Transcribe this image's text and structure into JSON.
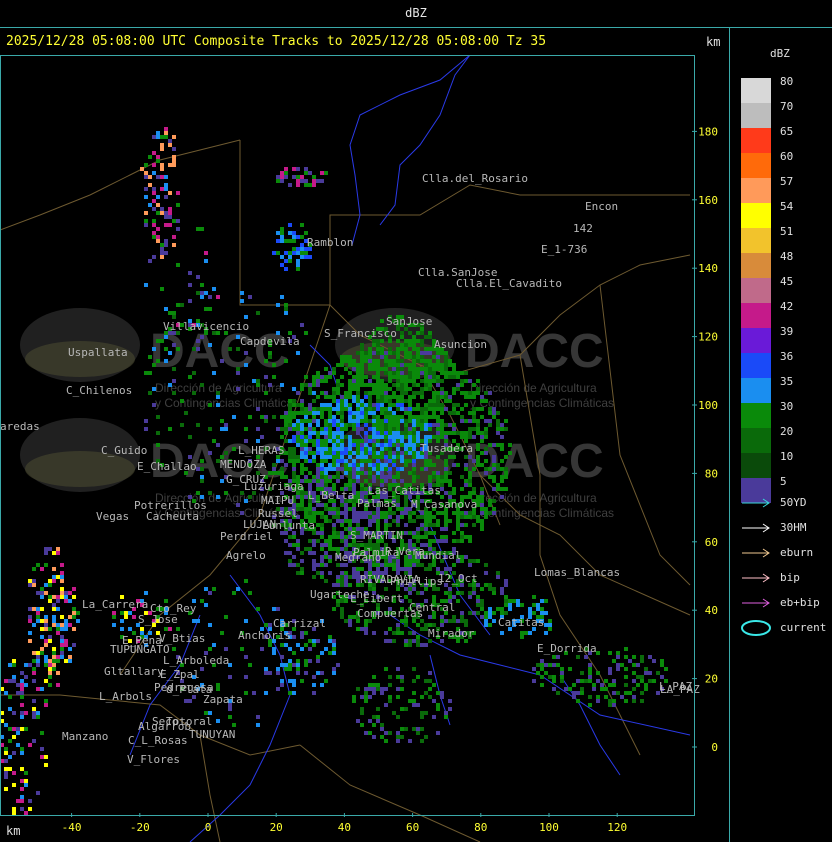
{
  "window_title": "dBZ",
  "header": "2025/12/28 05:08:00 UTC Composite Tracks to 2025/12/28 05:08:00 Tz 35",
  "km_label": "km",
  "legend": {
    "title": "dBZ",
    "scale": [
      {
        "label": "80",
        "color": "#d8d8d8"
      },
      {
        "label": "70",
        "color": "#bdbdbd"
      },
      {
        "label": "65",
        "color": "#ff3a1a"
      },
      {
        "label": "60",
        "color": "#ff6a0a"
      },
      {
        "label": "57",
        "color": "#ff9a5a"
      },
      {
        "label": "54",
        "color": "#ffff00"
      },
      {
        "label": "51",
        "color": "#f2c32c"
      },
      {
        "label": "48",
        "color": "#d88b3a"
      },
      {
        "label": "45",
        "color": "#c06a8a"
      },
      {
        "label": "42",
        "color": "#c51a8a"
      },
      {
        "label": "39",
        "color": "#6a1ad8"
      },
      {
        "label": "36",
        "color": "#1a4af8"
      },
      {
        "label": "35",
        "color": "#1a8ef0"
      },
      {
        "label": "30",
        "color": "#0a8a0a"
      },
      {
        "label": "20",
        "color": "#0a6a0a"
      },
      {
        "label": "10",
        "color": "#0a4a0a"
      },
      {
        "label": "5",
        "color": "#4a3a9a"
      }
    ],
    "tracks": [
      {
        "label": "50YD",
        "color": "#3ad8d8",
        "type": "arrow"
      },
      {
        "label": "30HM",
        "color": "#ffffff",
        "type": "arrow"
      },
      {
        "label": "eburn",
        "color": "#f0c890",
        "type": "arrow"
      },
      {
        "label": "bip",
        "color": "#ffc0c8",
        "type": "arrow"
      },
      {
        "label": "eb+bip",
        "color": "#e060e0",
        "type": "arrow"
      },
      {
        "label": "current",
        "color": "#3ae8e8",
        "type": "ellipse"
      }
    ]
  },
  "axes": {
    "x_ticks": [
      "-40",
      "-20",
      "0",
      "20",
      "40",
      "60",
      "80",
      "100",
      "120"
    ],
    "y_ticks": [
      "180",
      "160",
      "140",
      "120",
      "100",
      "80",
      "60",
      "40",
      "20",
      "0"
    ]
  },
  "places": [
    {
      "name": "Clla.del_Rosario"
    },
    {
      "name": "Encon"
    },
    {
      "name": "142"
    },
    {
      "name": "E_1-736"
    },
    {
      "name": "Ramblon"
    },
    {
      "name": "Clla.SanJose"
    },
    {
      "name": "Clla.El_Cavadito"
    },
    {
      "name": "Villavicencio"
    },
    {
      "name": "Uspallata"
    },
    {
      "name": "Capdevila"
    },
    {
      "name": "S_Francisco"
    },
    {
      "name": "SanJose"
    },
    {
      "name": "Asuncion"
    },
    {
      "name": "C_Chilenos"
    },
    {
      "name": "aredas"
    },
    {
      "name": "C_Guido"
    },
    {
      "name": "E_Challao"
    },
    {
      "name": "L_HERAS"
    },
    {
      "name": "MENDOZA"
    },
    {
      "name": "G_CRUZ"
    },
    {
      "name": "Luzuriaga"
    },
    {
      "name": "L_Belta"
    },
    {
      "name": "Las_Catitas"
    },
    {
      "name": "Tusadera"
    },
    {
      "name": "Potrerillos"
    },
    {
      "name": "Vegas"
    },
    {
      "name": "Cacheuta"
    },
    {
      "name": "MAIPU"
    },
    {
      "name": "Russel"
    },
    {
      "name": "LUJAN"
    },
    {
      "name": "Lunlunta"
    },
    {
      "name": "Palmas"
    },
    {
      "name": "M_Casanova"
    },
    {
      "name": "Perdriel"
    },
    {
      "name": "S_MARTIN"
    },
    {
      "name": "Palmira"
    },
    {
      "name": "R_Vera"
    },
    {
      "name": "Mundial"
    },
    {
      "name": "Agrelo"
    },
    {
      "name": "Medrano"
    },
    {
      "name": "RIVADAVIA"
    },
    {
      "name": "Phillips"
    },
    {
      "name": "12_Oct"
    },
    {
      "name": "Lomas_Blancas"
    },
    {
      "name": "Ugarteche"
    },
    {
      "name": "L_Libert"
    },
    {
      "name": "Compuertas"
    },
    {
      "name": "Central"
    },
    {
      "name": "LA_PAZ"
    },
    {
      "name": "Catitas"
    },
    {
      "name": "La_Carrera"
    },
    {
      "name": "Cto_Rey"
    },
    {
      "name": "S_Jose"
    },
    {
      "name": "Carrizal"
    },
    {
      "name": "E_Pena"
    },
    {
      "name": "TUPUNGATO"
    },
    {
      "name": "V_Btias"
    },
    {
      "name": "Anchoris"
    },
    {
      "name": "Mirador"
    },
    {
      "name": "E_Dorrida"
    },
    {
      "name": "E_Zpal"
    },
    {
      "name": "L_Arboleda"
    },
    {
      "name": "Gltallary"
    },
    {
      "name": "d_Plata"
    },
    {
      "name": "L_Arbols"
    },
    {
      "name": "Zapata"
    },
    {
      "name": "Seco"
    },
    {
      "name": "Totoral"
    },
    {
      "name": "TUNUYAN"
    },
    {
      "name": "Manzano"
    },
    {
      "name": "C_L_Rosas"
    },
    {
      "name": "V_Flores"
    },
    {
      "name": "L_PAZ"
    },
    {
      "name": "Algarrob"
    },
    {
      "name": "Pedregosa"
    }
  ],
  "watermark": {
    "brand": "DACC",
    "line1": "Dirección de Agricultura",
    "line2": "y Contingencias Climáticas"
  }
}
